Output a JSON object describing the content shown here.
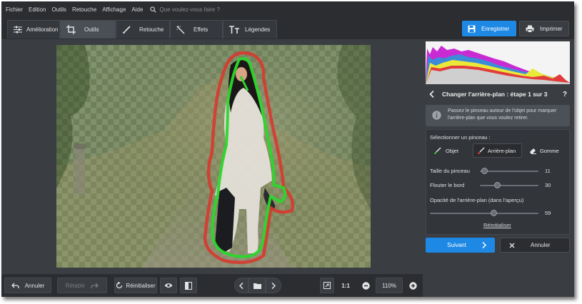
{
  "menu": [
    "Fichier",
    "Edition",
    "Outils",
    "Retouche",
    "Affichage",
    "Aide"
  ],
  "search": {
    "placeholder": "Que voulez-vous faire ?",
    "icon": "search-icon"
  },
  "tabs": [
    {
      "label": "Amélioration",
      "icon": "sliders-icon"
    },
    {
      "label": "Outils",
      "icon": "crop-icon"
    },
    {
      "label": "Retouche",
      "icon": "brush-icon"
    },
    {
      "label": "Effets",
      "icon": "magic-wand-icon"
    },
    {
      "label": "Légendes",
      "icon": "text-icon"
    }
  ],
  "active_tab": "Outils",
  "actions": {
    "save": "Enregistrer",
    "print": "Imprimer"
  },
  "panel": {
    "step_title": "Changer l'arrière-plan : étape 1 sur 3",
    "help": "?",
    "info": "Passez le pinceau autour de l'objet pour marquer l'arrière-plan que vous voulez retirer.",
    "brush_heading": "Sélectionner un pinceau :",
    "brushes": {
      "object": "Objet",
      "background": "Arrière-plan",
      "eraser": "Gomme"
    },
    "active_brush": "Arrière-plan",
    "sliders": {
      "size": {
        "label": "Taille du pinceau",
        "value": "11",
        "fraction": 0.08
      },
      "feather": {
        "label": "Flouter le bord",
        "value": "30",
        "fraction": 0.3
      },
      "opacity": {
        "label": "Opacité de l'arrière-plan (dans l'aperçu)",
        "value": "59",
        "fraction": 0.59
      }
    },
    "reset_link": "Réinitialiser",
    "next": "Suivant",
    "cancel": "Annuler"
  },
  "bottom": {
    "undo": "Annuler",
    "redo": "Rétablir",
    "reset": "Réinitialiser",
    "zoom_fit": "1:1",
    "zoom": "110%"
  },
  "colors": {
    "accent": "#1e88e5",
    "object_stroke": "#2bd72b",
    "background_stroke": "#d63a30"
  }
}
